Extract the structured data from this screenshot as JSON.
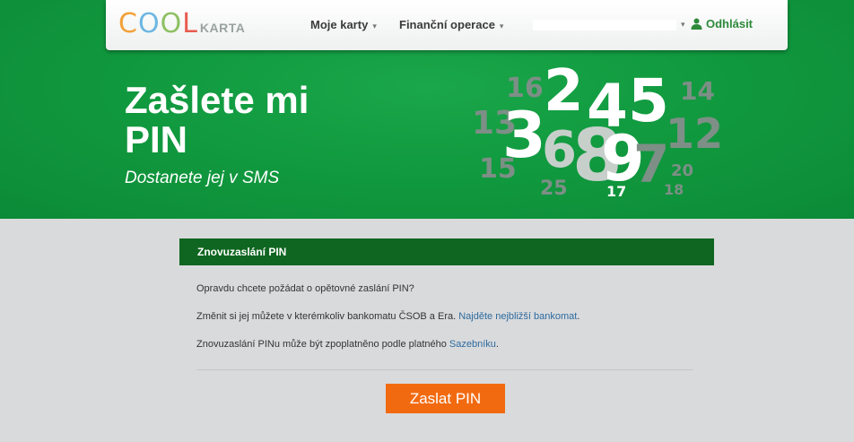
{
  "brand": {
    "logo_cool": [
      "C",
      "O",
      "O",
      "L"
    ],
    "logo_karta": "KARTA"
  },
  "nav": {
    "items": [
      {
        "label": "Moje karty"
      },
      {
        "label": "Finanční operace"
      }
    ],
    "logout_label": "Odhlásit"
  },
  "hero": {
    "title": "Zašlete mi PIN",
    "subtitle": "Dostanete jej v SMS",
    "digits": [
      "16",
      "2",
      "4",
      "5",
      "14",
      "13",
      "3",
      "6",
      "12",
      "15",
      "8",
      "9",
      "7",
      "20",
      "25",
      "17",
      "18"
    ]
  },
  "panel": {
    "title": "Znovuzaslání PIN",
    "line1": "Opravdu chcete požádat o opětovné zaslání PIN?",
    "line2_text": "Změnit si jej můžete v kterémkoliv bankomatu ČSOB a Era.",
    "line2_link": "Najděte nejbližší bankomat",
    "line2_end": ".",
    "line3_text": "Znovuzaslání PINu může být zpoplatněno podle platného",
    "line3_link": "Sazebníku",
    "line3_end": ".",
    "submit_label": "Zaslat PIN"
  },
  "colors": {
    "hero_green": "#119a3f",
    "panel_header": "#0f6620",
    "button_orange": "#f26a10",
    "link_blue": "#2d6a9e"
  }
}
